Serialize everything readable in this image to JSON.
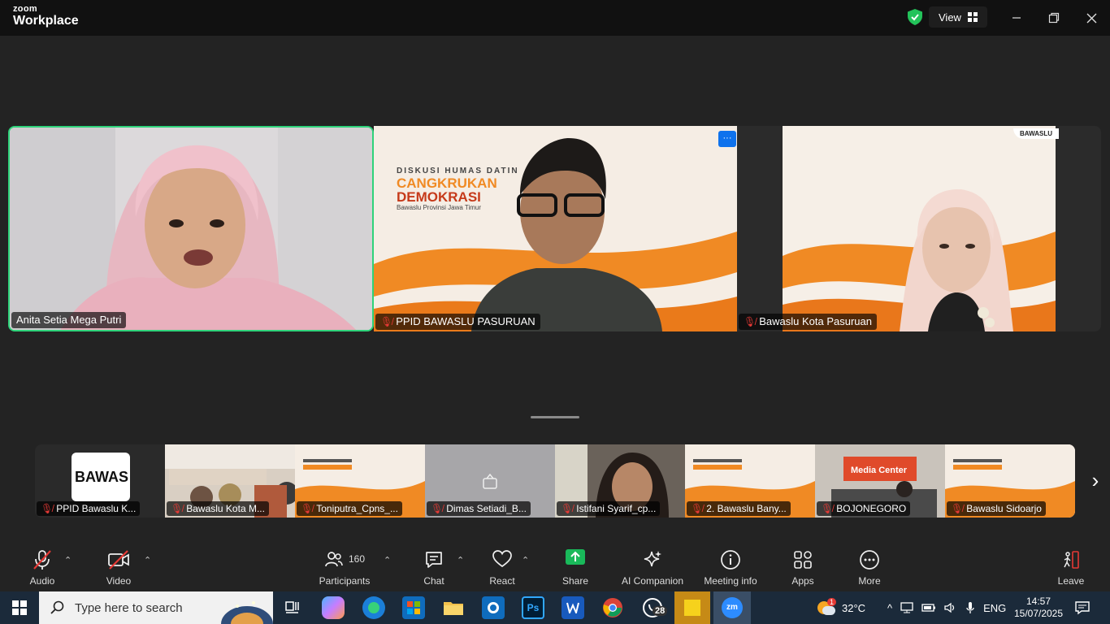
{
  "app": {
    "brand_top": "zoom",
    "brand_bottom": "Workplace"
  },
  "titlebar": {
    "view_label": "View"
  },
  "gallery": [
    {
      "name": "Anita Setia Mega Putri",
      "muted": false,
      "active_speaker": true
    },
    {
      "name": "PPID BAWASLU PASURUAN",
      "muted": true
    },
    {
      "name": "Bawaslu Kota Pasuruan",
      "muted": true
    }
  ],
  "slide_text": {
    "line1": "DISKUSI HUMAS DATIN",
    "line2": "CANGKRUKAN",
    "line3": "DEMOKRASI",
    "line4": "Bawaslu Provinsi Jawa Timur",
    "logo": "BAWASLU"
  },
  "more_menu_label": "···",
  "strip": [
    {
      "name": "PPID Bawaslu K...",
      "muted": true,
      "bg": "logo",
      "logo_text": "BAWAS"
    },
    {
      "name": "Bawaslu Kota M...",
      "muted": true,
      "bg": "room"
    },
    {
      "name": "Toniputra_Cpns_...",
      "muted": true,
      "bg": "slide"
    },
    {
      "name": "Dimas Setiadi_B...",
      "muted": true,
      "bg": "grey"
    },
    {
      "name": "Istifani Syarif_cp...",
      "muted": true,
      "bg": "person"
    },
    {
      "name": "2. Bawaslu Bany...",
      "muted": true,
      "bg": "slide"
    },
    {
      "name": "BOJONEGORO",
      "muted": true,
      "bg": "media",
      "banner": "Media Center"
    },
    {
      "name": "Bawaslu Sidoarjo",
      "muted": true,
      "bg": "slide"
    }
  ],
  "toolbar": {
    "audio": "Audio",
    "video": "Video",
    "participants": "Participants",
    "participants_count": "160",
    "chat": "Chat",
    "react": "React",
    "share": "Share",
    "ai": "AI Companion",
    "meeting_info": "Meeting info",
    "apps": "Apps",
    "more": "More",
    "leave": "Leave"
  },
  "taskbar": {
    "search_placeholder": "Type here to search",
    "whatsapp_badge": "28",
    "temperature": "32°C",
    "weather_badge": "1",
    "language": "ENG",
    "time": "14:57",
    "date": "15/07/2025",
    "photoshop_label": "Ps",
    "zoom_label": "zm"
  },
  "colors": {
    "active_speaker_border": "#2ed37a",
    "share_green": "#19b95a",
    "muted_red": "#e53935",
    "slide_orange": "#f08a24"
  }
}
